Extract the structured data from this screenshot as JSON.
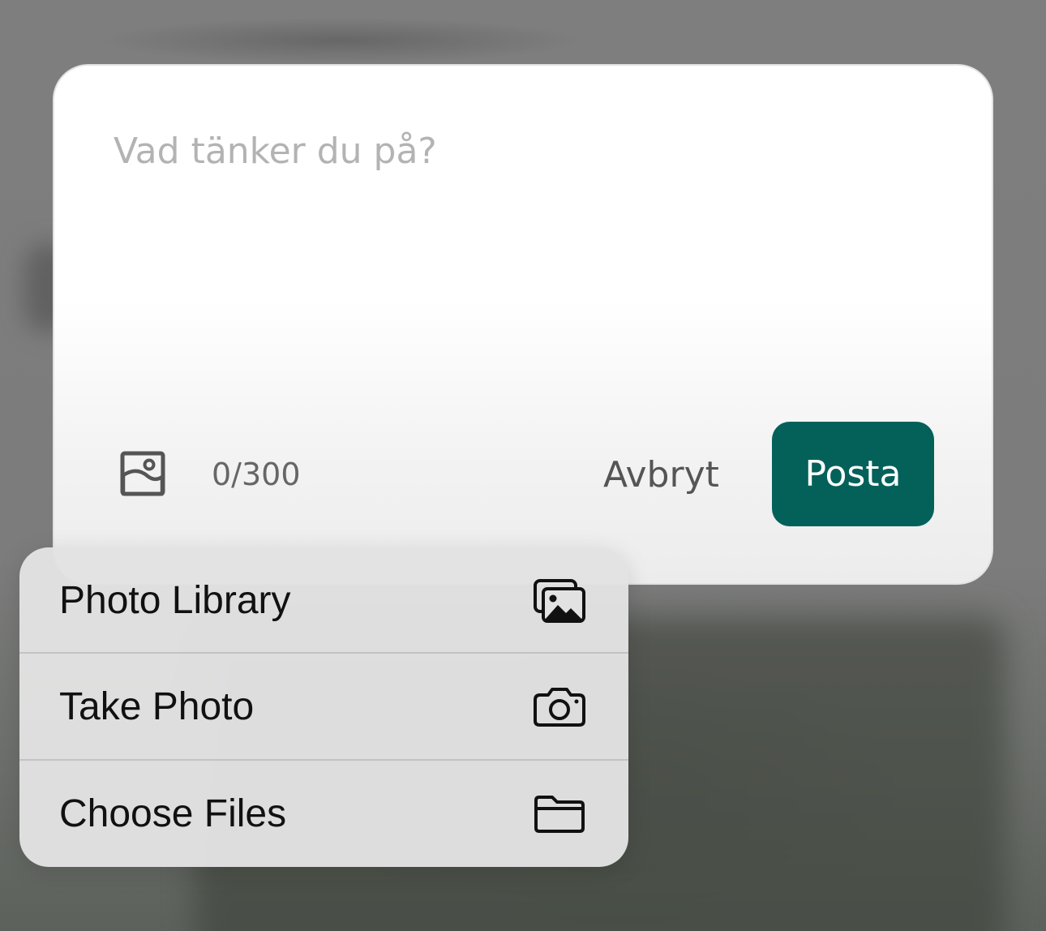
{
  "composer": {
    "placeholder": "Vad tänker du på?",
    "text_value": "",
    "image_icon": "image-icon",
    "char_count": "0/300",
    "cancel_label": "Avbryt",
    "post_label": "Posta",
    "post_button_color": "#03615a"
  },
  "attachment_menu": {
    "items": [
      {
        "label": "Photo Library",
        "icon": "photo-library-icon"
      },
      {
        "label": "Take Photo",
        "icon": "camera-icon"
      },
      {
        "label": "Choose Files",
        "icon": "folder-icon"
      }
    ]
  }
}
